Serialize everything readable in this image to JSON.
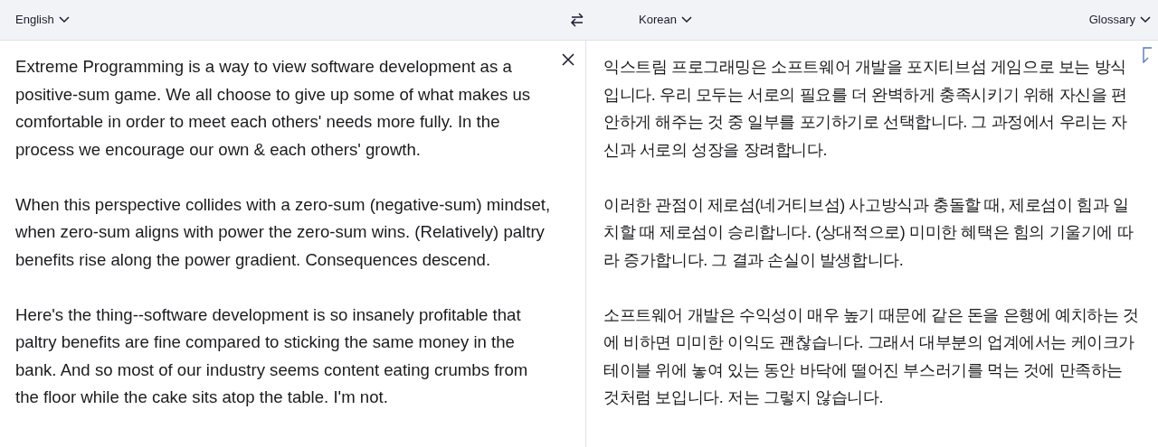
{
  "toolbar": {
    "source_language": "English",
    "target_language": "Korean",
    "glossary": "Glossary"
  },
  "source": {
    "paragraphs": [
      "Extreme Programming is a way to view software development as a positive-sum game. We all choose to give up some of what makes us comfortable in order to meet each others' needs more fully. In the process we encourage our own & each others' growth.",
      "When this perspective collides with a zero-sum (negative-sum) mindset, when zero-sum aligns with power the zero-sum wins. (Relatively) paltry benefits rise along the power gradient. Consequences descend.",
      "Here's the thing--software development is so insanely profitable that paltry benefits are fine compared to sticking the same money in the bank. And so most of our industry seems content eating crumbs from the floor while the cake sits atop the table. I'm not."
    ]
  },
  "translation": {
    "paragraphs": [
      "익스트림 프로그래밍은 소프트웨어 개발을 포지티브섬 게임으로 보는 방식입니다. 우리 모두는 서로의 필요를 더 완벽하게 충족시키기 위해 자신을 편안하게 해주는 것 중 일부를 포기하기로 선택합니다. 그 과정에서 우리는 자신과 서로의 성장을 장려합니다.",
      "이러한 관점이 제로섬(네거티브섬) 사고방식과 충돌할 때, 제로섬이 힘과 일치할 때 제로섬이 승리합니다. (상대적으로) 미미한 혜택은 힘의 기울기에 따라 증가합니다. 그 결과 손실이 발생합니다.",
      "소프트웨어 개발은 수익성이 매우 높기 때문에 같은 돈을 은행에 예치하는 것에 비하면 미미한 이익도 괜찮습니다. 그래서 대부분의 업계에서는 케이크가 테이블 위에 놓여 있는 동안 바닥에 떨어진 부스러기를 먹는 것에 만족하는 것처럼 보입니다. 저는 그렇지 않습니다."
    ]
  }
}
